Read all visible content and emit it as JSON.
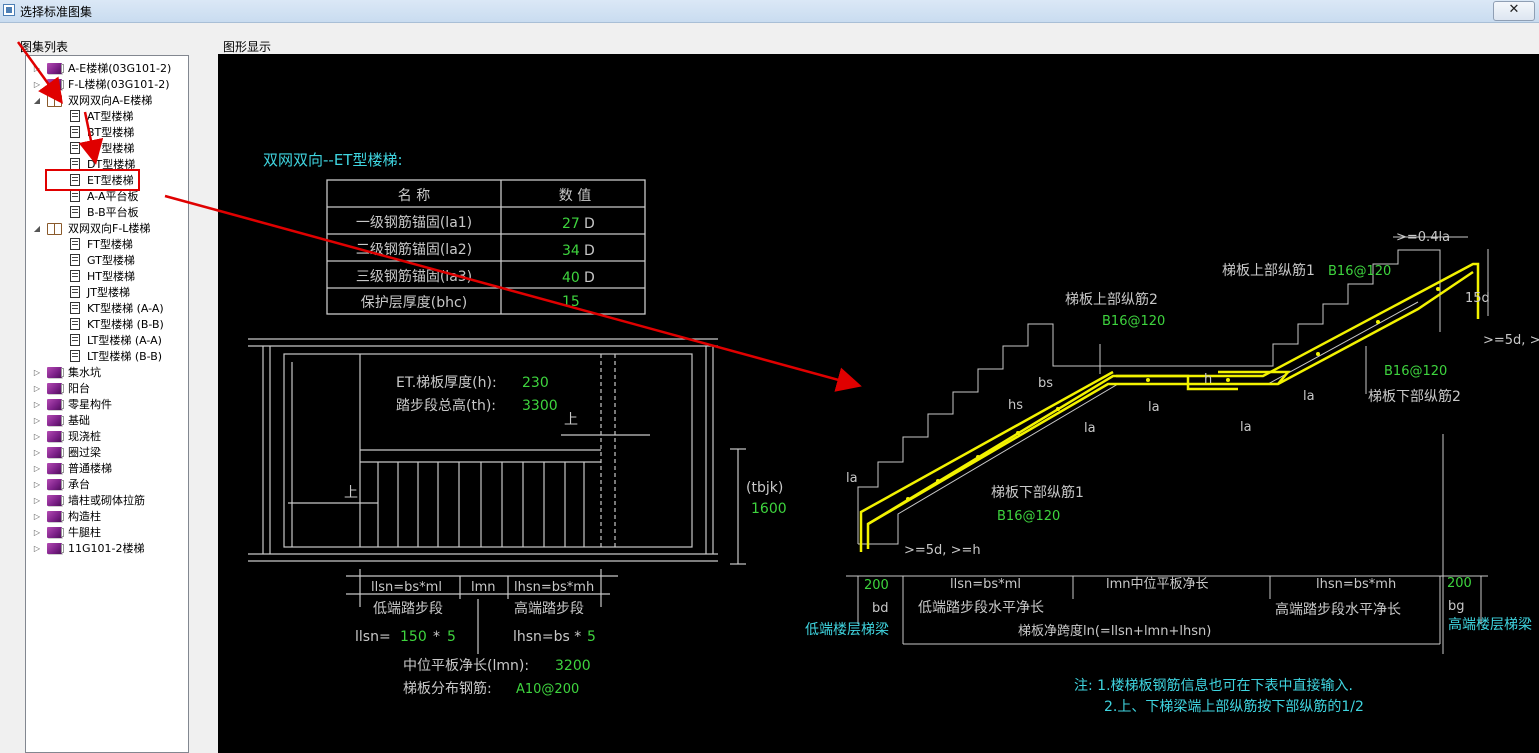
{
  "window": {
    "title": "选择标准图集",
    "close_glyph": "✕"
  },
  "tree_panel": {
    "label": "图集列表",
    "items": [
      {
        "label": "A-E楼梯(03G101-2)",
        "depth": 0,
        "expander": "▷",
        "icon": "book-icon"
      },
      {
        "label": "F-L楼梯(03G101-2)",
        "depth": 0,
        "expander": "▷",
        "icon": "book-icon"
      },
      {
        "label": "双网双向A-E楼梯",
        "depth": 0,
        "expander": "◢",
        "icon": "book-open-icon"
      },
      {
        "label": "AT型楼梯",
        "depth": 1,
        "expander": "",
        "icon": "doc-icon"
      },
      {
        "label": "BT型楼梯",
        "depth": 1,
        "expander": "",
        "icon": "doc-icon"
      },
      {
        "label": "CT型楼梯",
        "depth": 1,
        "expander": "",
        "icon": "doc-icon"
      },
      {
        "label": "DT型楼梯",
        "depth": 1,
        "expander": "",
        "icon": "doc-icon"
      },
      {
        "label": "ET型楼梯",
        "depth": 1,
        "expander": "",
        "icon": "doc-icon",
        "selected": true
      },
      {
        "label": "A-A平台板",
        "depth": 1,
        "expander": "",
        "icon": "doc-icon"
      },
      {
        "label": "B-B平台板",
        "depth": 1,
        "expander": "",
        "icon": "doc-icon"
      },
      {
        "label": "双网双向F-L楼梯",
        "depth": 0,
        "expander": "◢",
        "icon": "book-open-icon"
      },
      {
        "label": "FT型楼梯",
        "depth": 1,
        "expander": "",
        "icon": "doc-icon"
      },
      {
        "label": "GT型楼梯",
        "depth": 1,
        "expander": "",
        "icon": "doc-icon"
      },
      {
        "label": "HT型楼梯",
        "depth": 1,
        "expander": "",
        "icon": "doc-icon"
      },
      {
        "label": "JT型楼梯",
        "depth": 1,
        "expander": "",
        "icon": "doc-icon"
      },
      {
        "label": "KT型楼梯 (A-A)",
        "depth": 1,
        "expander": "",
        "icon": "doc-icon"
      },
      {
        "label": "KT型楼梯 (B-B)",
        "depth": 1,
        "expander": "",
        "icon": "doc-icon"
      },
      {
        "label": "LT型楼梯 (A-A)",
        "depth": 1,
        "expander": "",
        "icon": "doc-icon"
      },
      {
        "label": "LT型楼梯 (B-B)",
        "depth": 1,
        "expander": "",
        "icon": "doc-icon"
      },
      {
        "label": "集水坑",
        "depth": 0,
        "expander": "▷",
        "icon": "book-icon"
      },
      {
        "label": "阳台",
        "depth": 0,
        "expander": "▷",
        "icon": "book-icon"
      },
      {
        "label": "零星构件",
        "depth": 0,
        "expander": "▷",
        "icon": "book-icon"
      },
      {
        "label": "基础",
        "depth": 0,
        "expander": "▷",
        "icon": "book-icon"
      },
      {
        "label": "现浇桩",
        "depth": 0,
        "expander": "▷",
        "icon": "book-icon"
      },
      {
        "label": "圈过梁",
        "depth": 0,
        "expander": "▷",
        "icon": "book-icon"
      },
      {
        "label": "普通楼梯",
        "depth": 0,
        "expander": "▷",
        "icon": "book-icon"
      },
      {
        "label": "承台",
        "depth": 0,
        "expander": "▷",
        "icon": "book-icon"
      },
      {
        "label": "墙柱或砌体拉筋",
        "depth": 0,
        "expander": "▷",
        "icon": "book-icon"
      },
      {
        "label": "构造柱",
        "depth": 0,
        "expander": "▷",
        "icon": "book-icon"
      },
      {
        "label": "牛腿柱",
        "depth": 0,
        "expander": "▷",
        "icon": "book-icon"
      },
      {
        "label": "11G101-2楼梯",
        "depth": 0,
        "expander": "▷",
        "icon": "book-icon"
      }
    ]
  },
  "drawing_panel": {
    "label": "图形显示",
    "heading": "双网双向--ET型楼梯:",
    "table": {
      "headers": [
        "名 称",
        "数 值"
      ],
      "rows": [
        {
          "name": "一级钢筋锚固(la1)",
          "value": "27",
          "unit": "D"
        },
        {
          "name": "二级钢筋锚固(la2)",
          "value": "34",
          "unit": "D"
        },
        {
          "name": "三级钢筋锚固(la3)",
          "value": "40",
          "unit": "D"
        },
        {
          "name": "保护层厚度(bhc)",
          "value": "15",
          "unit": ""
        }
      ]
    },
    "plan": {
      "thickness_label": "ET.梯板厚度(h):",
      "thickness_value": "230",
      "height_label": "踏步段总高(th):",
      "height_value": "3300",
      "up_1": "上",
      "up_2": "上",
      "width_label": "(tbjk)",
      "width_value": "1600",
      "llsn_formula": "llsn=bs*ml",
      "lmn_label": "lmn",
      "lhsn_formula": "lhsn=bs*mh",
      "low_step": "低端踏步段",
      "high_step": "高端踏步段",
      "llsn_label": "llsn=",
      "llsn_bs": "150",
      "llsn_op": "*",
      "llsn_m": "5",
      "lhsn_label": "lhsn=bs *",
      "lhsn_m": "5",
      "mid_label": "中位平板净长(lmn):",
      "mid_value": "3200",
      "dist_label": "梯板分布钢筋:",
      "dist_value": "A10@200"
    },
    "section": {
      "top_bar1": "梯板上部纵筋1",
      "top_bar1_value": "B16@120",
      "top_bar2": "梯板上部纵筋2",
      "top_bar2_value": "B16@120",
      "bot_bar2_value": "B16@120",
      "bot_bar2": "梯板下部纵筋2",
      "bot_bar1": "梯板下部纵筋1",
      "bot_bar1_value": "B16@120",
      "anchor_04la": ">=0.4la",
      "d15": "15d",
      "d5_right": ">=5d, >",
      "bs": "bs",
      "hs": "hs",
      "h": "h",
      "la": "la",
      "d5_left": ">=5d, >=h",
      "bd_value": "200",
      "bg_value": "200",
      "dim_llsn": "llsn=bs*ml",
      "dim_lmn": "lmn中位平板净长",
      "dim_lhsn": "lhsn=bs*mh",
      "bd": "bd",
      "bg": "bg",
      "low_horiz": "低端踏步段水平净长",
      "high_horiz": "高端踏步段水平净长",
      "span": "梯板净跨度ln(=llsn+lmn+lhsn)",
      "low_beam": "低端楼层梯梁",
      "high_beam": "高端楼层梯梁"
    },
    "notes": [
      "注: 1.楼梯板钢筋信息也可在下表中直接输入.",
      "2.上、下梯梁端上部纵筋按下部纵筋的1/2"
    ]
  },
  "colors": {
    "cad_cyan": "#3fd5e0",
    "cad_green": "#3ed43e",
    "cad_yellow": "#f2f200",
    "cad_white": "#ffffff",
    "cad_grey": "#c8c8c8",
    "annotation_red": "#e00000"
  }
}
